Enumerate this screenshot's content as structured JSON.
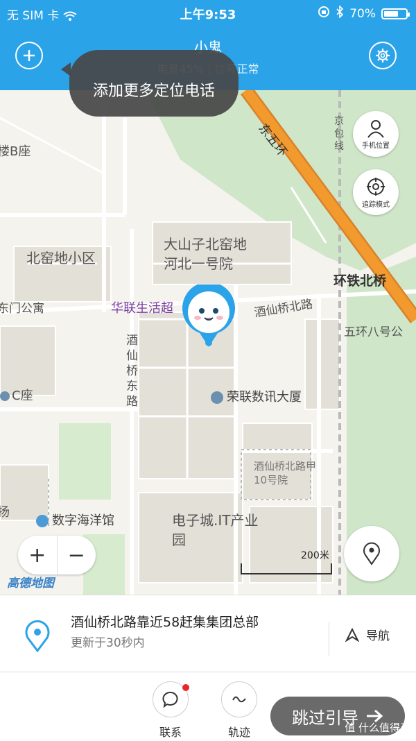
{
  "status_bar": {
    "carrier": "无 SIM 卡",
    "time": "上午9:53",
    "battery_percent": "70%",
    "battery_level": 0.7
  },
  "header": {
    "title": "小鬼",
    "subtitle": "电量45% | 信号正常",
    "tooltip": "添加更多定位电话"
  },
  "map": {
    "labels": {
      "building_b": "楼B座",
      "dongwuhuan": "东五环",
      "jingbao": "京包线",
      "beiyao": "北窑地小区",
      "dashanzi": "大山子北窑地",
      "hebei": "河北一号院",
      "huantie": "环铁北桥",
      "dongmen": "东门公寓",
      "hualian": "华联生活超",
      "jiuxianqiao_road": "酒仙桥北路",
      "wuhuan8": "五环八号公",
      "jiuxianqiao_east": "酒仙桥东路",
      "c_block": "C座",
      "ronglian": "荣联数讯大厦",
      "jiuxianqiao_10": "酒仙桥北路甲10号院",
      "yang": "扬",
      "ocean": "数字海洋馆",
      "dianzicheng": "电子城.IT产业园",
      "scale": "200米",
      "logo": "高德地图"
    },
    "phone_location_label": "手机位置",
    "track_mode_label": "追踪模式",
    "zoom_in": "+",
    "zoom_out": "−"
  },
  "info": {
    "address": "酒仙桥北路靠近58赶集集团总部",
    "updated": "更新于30秒内",
    "nav_label": "导航"
  },
  "bottom": {
    "contact_label": "联系",
    "track_label": "轨迹",
    "skip_label": "跳过引导",
    "watermark": "值 什么值得买"
  },
  "colors": {
    "header_bg": "#2ba3e8",
    "highway": "#f29a2e",
    "green": "#cfe6c8",
    "notification_dot": "#e8262a"
  }
}
